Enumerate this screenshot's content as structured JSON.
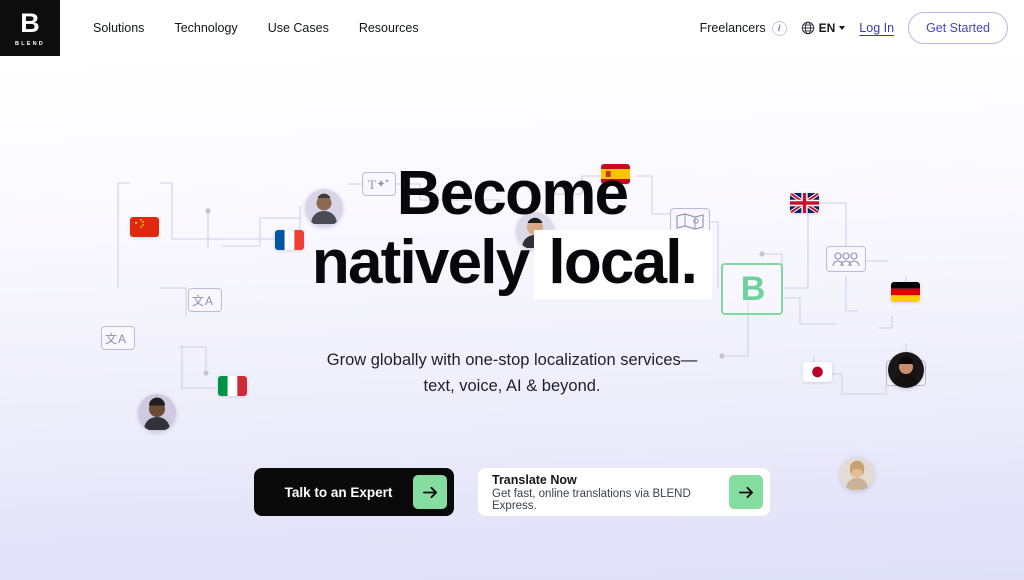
{
  "brand": {
    "logo_letter": "B",
    "logo_wordmark": "BLEND",
    "accent_green": "#86dda1",
    "accent_purple": "#4a45c4",
    "hero_bg_top": "#ffffff",
    "hero_bg_bottom": "#e0e1f8"
  },
  "header": {
    "nav": [
      {
        "label": "Solutions"
      },
      {
        "label": "Technology"
      },
      {
        "label": "Use Cases"
      },
      {
        "label": "Resources"
      }
    ],
    "freelancers_label": "Freelancers",
    "info_icon": "info-icon",
    "globe_icon": "globe-icon",
    "language": "EN",
    "login_label": "Log In",
    "get_started_label": "Get Started"
  },
  "hero": {
    "headline_line1": "Become",
    "headline_line2_plain": "natively",
    "headline_line2_highlight": "local.",
    "subhead_line1": "Grow globally with one-stop localization services—",
    "subhead_line2": "text, voice, AI & beyond.",
    "blend_mark_letter": "B"
  },
  "cta": {
    "primary_label": "Talk to an Expert",
    "primary_arrow": "arrow-right-icon",
    "secondary_title": "Translate Now",
    "secondary_sub": "Get fast, online translations via BLEND Express.",
    "secondary_arrow": "arrow-right-icon"
  },
  "decor": {
    "flags": [
      "china-flag",
      "france-flag",
      "italy-flag",
      "spain-flag",
      "uk-flag",
      "germany-flag",
      "japan-flag"
    ],
    "icons": [
      "translate-icon",
      "ai-text-icon",
      "map-icon",
      "people-group-icon",
      "goal-flag-icon"
    ],
    "avatars": [
      "avatar-1",
      "avatar-2",
      "avatar-3",
      "avatar-4",
      "avatar-5"
    ]
  }
}
